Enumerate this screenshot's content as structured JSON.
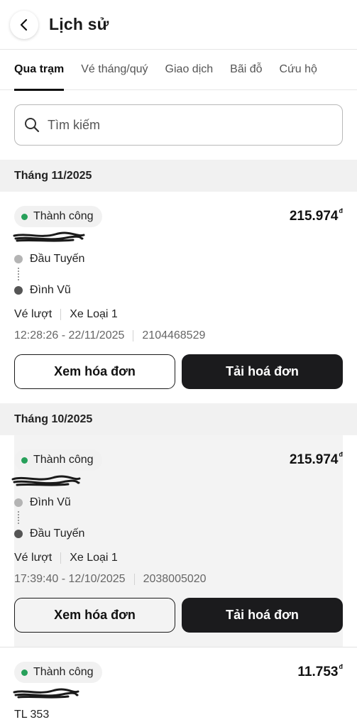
{
  "header": {
    "title": "Lịch sử"
  },
  "tabs": [
    "Qua trạm",
    "Vé tháng/quý",
    "Giao dịch",
    "Bãi đỗ",
    "Cứu hộ"
  ],
  "search": {
    "placeholder": "Tìm kiếm"
  },
  "groups": [
    {
      "month": "Tháng 11/2025",
      "items": [
        {
          "status": "Thành công",
          "amount": "215.974",
          "currency": "đ",
          "from": "Đầu Tuyến",
          "to": "Đình Vũ",
          "ticket_type": "Vé lượt",
          "vehicle": "Xe Loại 1",
          "datetime": "12:28:26 - 22/11/2025",
          "transaction_id": "2104468529",
          "view_invoice": "Xem hóa đơn",
          "download_invoice": "Tải hoá đơn"
        }
      ]
    },
    {
      "month": "Tháng 10/2025",
      "items": [
        {
          "status": "Thành công",
          "amount": "215.974",
          "currency": "đ",
          "from": "Đình Vũ",
          "to": "Đầu Tuyến",
          "ticket_type": "Vé lượt",
          "vehicle": "Xe Loại 1",
          "datetime": "17:39:40 - 12/10/2025",
          "transaction_id": "2038005020",
          "view_invoice": "Xem hóa đơn",
          "download_invoice": "Tải hoá đơn"
        },
        {
          "status": "Thành công",
          "amount": "11.753",
          "currency": "đ",
          "station": "TL 353"
        }
      ]
    }
  ],
  "colors": {
    "success": "#27a05a",
    "primary_button": "#1b1b1d"
  }
}
